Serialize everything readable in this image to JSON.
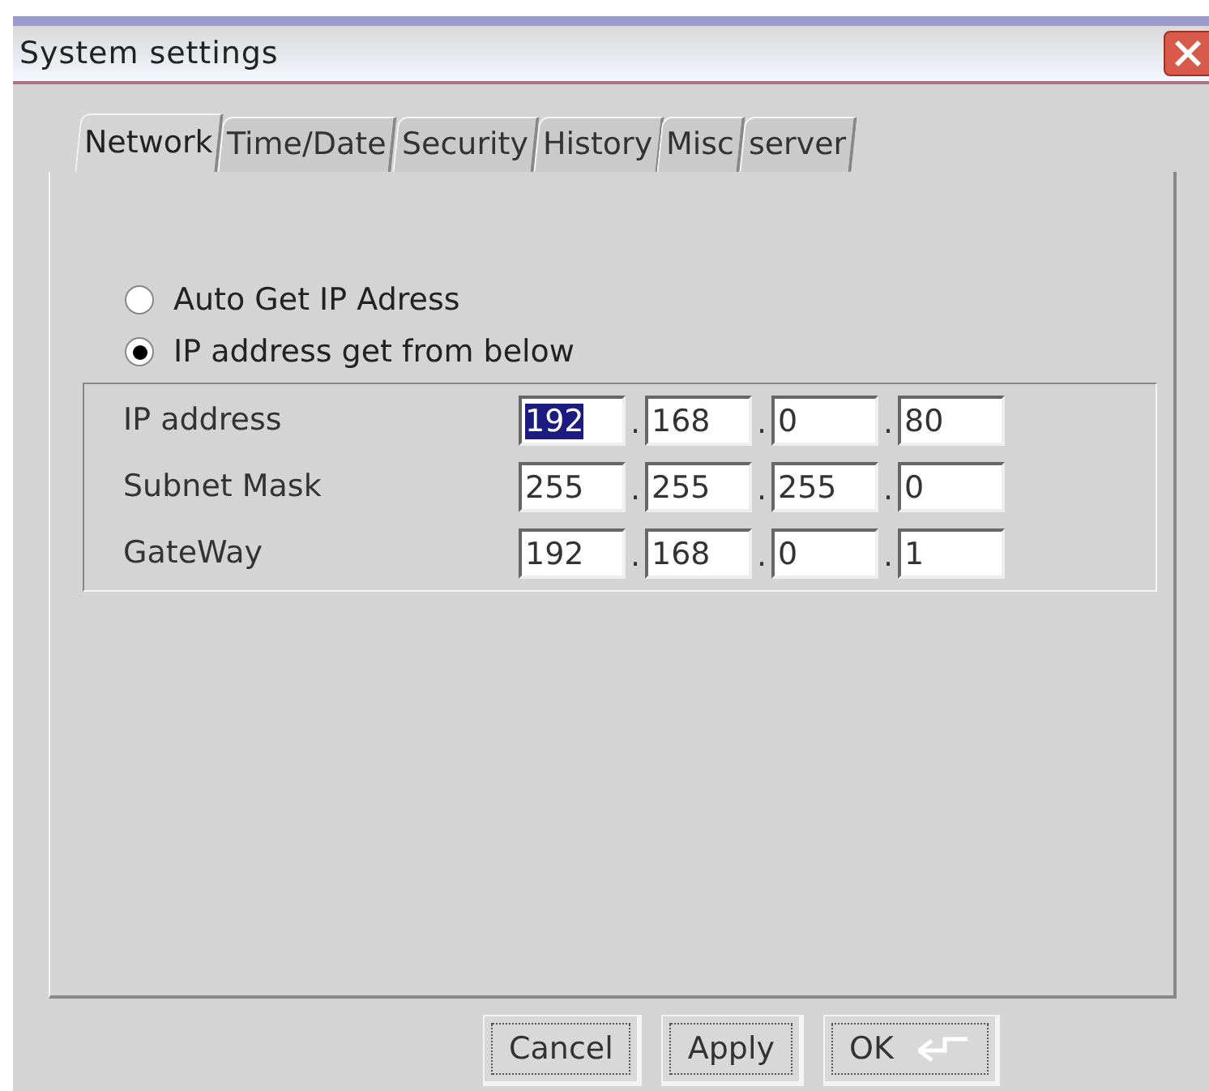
{
  "window": {
    "title": "System settings"
  },
  "tabs": [
    {
      "label": "Network",
      "selected": true
    },
    {
      "label": "Time/Date",
      "selected": false
    },
    {
      "label": "Security",
      "selected": false
    },
    {
      "label": "History",
      "selected": false
    },
    {
      "label": "Misc",
      "selected": false
    },
    {
      "label": "server",
      "selected": false
    }
  ],
  "ip_mode": [
    {
      "label": "Auto Get IP Adress",
      "selected": false
    },
    {
      "label": "IP address get from below",
      "selected": true
    }
  ],
  "fields": [
    {
      "label": "IP address",
      "octets": [
        {
          "value": "192",
          "selected": true
        },
        {
          "value": "168",
          "selected": false
        },
        {
          "value": "0",
          "selected": false
        },
        {
          "value": "80",
          "selected": false
        }
      ]
    },
    {
      "label": "Subnet Mask",
      "octets": [
        {
          "value": "255",
          "selected": false
        },
        {
          "value": "255",
          "selected": false
        },
        {
          "value": "255",
          "selected": false
        },
        {
          "value": "0",
          "selected": false
        }
      ]
    },
    {
      "label": "GateWay",
      "octets": [
        {
          "value": "192",
          "selected": false
        },
        {
          "value": "168",
          "selected": false
        },
        {
          "value": "0",
          "selected": false
        },
        {
          "value": "1",
          "selected": false
        }
      ]
    }
  ],
  "separator": ".",
  "buttons": [
    {
      "label": "Cancel",
      "kind": "plain"
    },
    {
      "label": "Apply",
      "kind": "plain"
    },
    {
      "label": "OK",
      "kind": "enter"
    }
  ]
}
